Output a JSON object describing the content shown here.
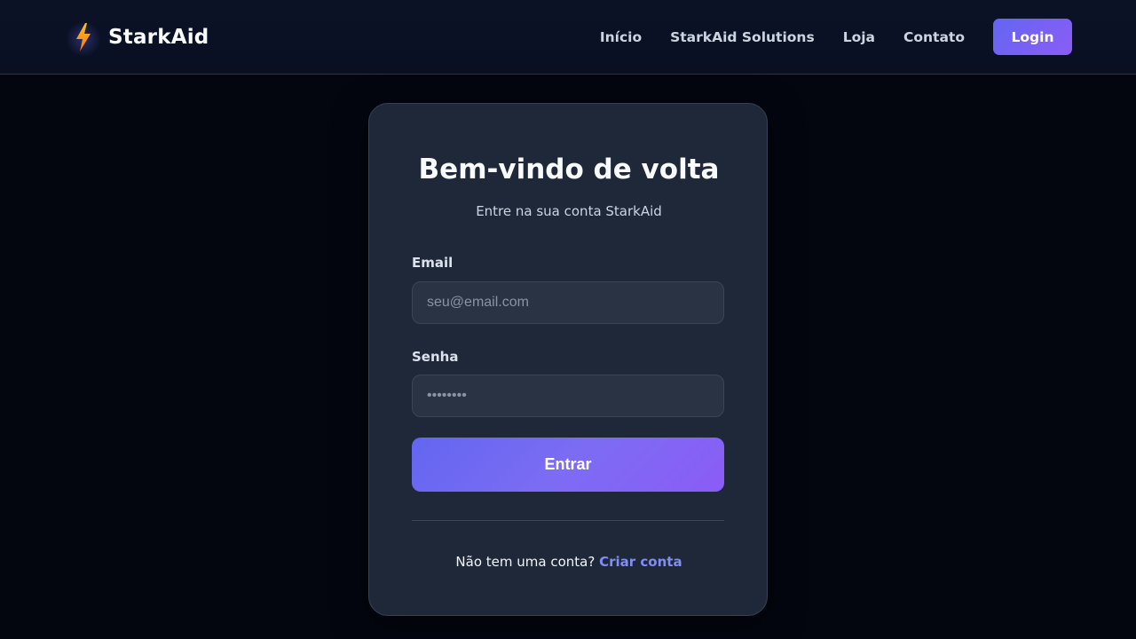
{
  "header": {
    "brand_name": "StarkAid",
    "brand_icon": "lightning-bolt-icon",
    "nav": {
      "home": "Início",
      "solutions": "StarkAid Solutions",
      "store": "Loja",
      "contact": "Contato"
    },
    "login_label": "Login"
  },
  "login_card": {
    "title": "Bem-vindo de volta",
    "subtitle": "Entre na sua conta StarkAid",
    "email_label": "Email",
    "email_placeholder": "seu@email.com",
    "password_label": "Senha",
    "password_placeholder": "••••••••",
    "submit_label": "Entrar",
    "signup_prompt": "Não tem uma conta?",
    "signup_link": "Criar conta"
  },
  "colors": {
    "accent_start": "#6366f1",
    "accent_end": "#8b5cf6",
    "card_background": "#1f2839",
    "page_background": "#03060f",
    "link": "#818cf8",
    "bolt": "#f59e0b"
  }
}
